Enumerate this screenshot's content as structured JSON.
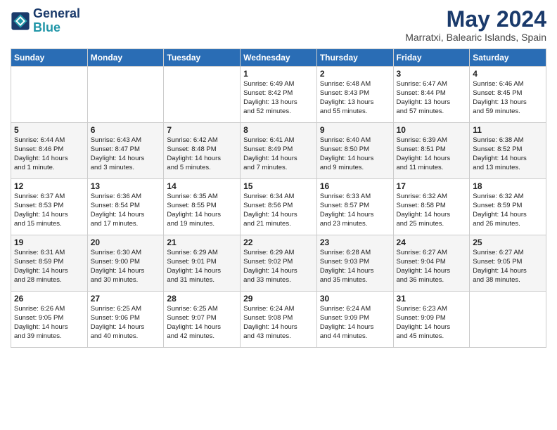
{
  "logo": {
    "line1": "General",
    "line2": "Blue"
  },
  "title": "May 2024",
  "location": "Marratxi, Balearic Islands, Spain",
  "days_of_week": [
    "Sunday",
    "Monday",
    "Tuesday",
    "Wednesday",
    "Thursday",
    "Friday",
    "Saturday"
  ],
  "weeks": [
    [
      {
        "day": "",
        "info": ""
      },
      {
        "day": "",
        "info": ""
      },
      {
        "day": "",
        "info": ""
      },
      {
        "day": "1",
        "info": "Sunrise: 6:49 AM\nSunset: 8:42 PM\nDaylight: 13 hours\nand 52 minutes."
      },
      {
        "day": "2",
        "info": "Sunrise: 6:48 AM\nSunset: 8:43 PM\nDaylight: 13 hours\nand 55 minutes."
      },
      {
        "day": "3",
        "info": "Sunrise: 6:47 AM\nSunset: 8:44 PM\nDaylight: 13 hours\nand 57 minutes."
      },
      {
        "day": "4",
        "info": "Sunrise: 6:46 AM\nSunset: 8:45 PM\nDaylight: 13 hours\nand 59 minutes."
      }
    ],
    [
      {
        "day": "5",
        "info": "Sunrise: 6:44 AM\nSunset: 8:46 PM\nDaylight: 14 hours\nand 1 minute."
      },
      {
        "day": "6",
        "info": "Sunrise: 6:43 AM\nSunset: 8:47 PM\nDaylight: 14 hours\nand 3 minutes."
      },
      {
        "day": "7",
        "info": "Sunrise: 6:42 AM\nSunset: 8:48 PM\nDaylight: 14 hours\nand 5 minutes."
      },
      {
        "day": "8",
        "info": "Sunrise: 6:41 AM\nSunset: 8:49 PM\nDaylight: 14 hours\nand 7 minutes."
      },
      {
        "day": "9",
        "info": "Sunrise: 6:40 AM\nSunset: 8:50 PM\nDaylight: 14 hours\nand 9 minutes."
      },
      {
        "day": "10",
        "info": "Sunrise: 6:39 AM\nSunset: 8:51 PM\nDaylight: 14 hours\nand 11 minutes."
      },
      {
        "day": "11",
        "info": "Sunrise: 6:38 AM\nSunset: 8:52 PM\nDaylight: 14 hours\nand 13 minutes."
      }
    ],
    [
      {
        "day": "12",
        "info": "Sunrise: 6:37 AM\nSunset: 8:53 PM\nDaylight: 14 hours\nand 15 minutes."
      },
      {
        "day": "13",
        "info": "Sunrise: 6:36 AM\nSunset: 8:54 PM\nDaylight: 14 hours\nand 17 minutes."
      },
      {
        "day": "14",
        "info": "Sunrise: 6:35 AM\nSunset: 8:55 PM\nDaylight: 14 hours\nand 19 minutes."
      },
      {
        "day": "15",
        "info": "Sunrise: 6:34 AM\nSunset: 8:56 PM\nDaylight: 14 hours\nand 21 minutes."
      },
      {
        "day": "16",
        "info": "Sunrise: 6:33 AM\nSunset: 8:57 PM\nDaylight: 14 hours\nand 23 minutes."
      },
      {
        "day": "17",
        "info": "Sunrise: 6:32 AM\nSunset: 8:58 PM\nDaylight: 14 hours\nand 25 minutes."
      },
      {
        "day": "18",
        "info": "Sunrise: 6:32 AM\nSunset: 8:59 PM\nDaylight: 14 hours\nand 26 minutes."
      }
    ],
    [
      {
        "day": "19",
        "info": "Sunrise: 6:31 AM\nSunset: 8:59 PM\nDaylight: 14 hours\nand 28 minutes."
      },
      {
        "day": "20",
        "info": "Sunrise: 6:30 AM\nSunset: 9:00 PM\nDaylight: 14 hours\nand 30 minutes."
      },
      {
        "day": "21",
        "info": "Sunrise: 6:29 AM\nSunset: 9:01 PM\nDaylight: 14 hours\nand 31 minutes."
      },
      {
        "day": "22",
        "info": "Sunrise: 6:29 AM\nSunset: 9:02 PM\nDaylight: 14 hours\nand 33 minutes."
      },
      {
        "day": "23",
        "info": "Sunrise: 6:28 AM\nSunset: 9:03 PM\nDaylight: 14 hours\nand 35 minutes."
      },
      {
        "day": "24",
        "info": "Sunrise: 6:27 AM\nSunset: 9:04 PM\nDaylight: 14 hours\nand 36 minutes."
      },
      {
        "day": "25",
        "info": "Sunrise: 6:27 AM\nSunset: 9:05 PM\nDaylight: 14 hours\nand 38 minutes."
      }
    ],
    [
      {
        "day": "26",
        "info": "Sunrise: 6:26 AM\nSunset: 9:05 PM\nDaylight: 14 hours\nand 39 minutes."
      },
      {
        "day": "27",
        "info": "Sunrise: 6:25 AM\nSunset: 9:06 PM\nDaylight: 14 hours\nand 40 minutes."
      },
      {
        "day": "28",
        "info": "Sunrise: 6:25 AM\nSunset: 9:07 PM\nDaylight: 14 hours\nand 42 minutes."
      },
      {
        "day": "29",
        "info": "Sunrise: 6:24 AM\nSunset: 9:08 PM\nDaylight: 14 hours\nand 43 minutes."
      },
      {
        "day": "30",
        "info": "Sunrise: 6:24 AM\nSunset: 9:09 PM\nDaylight: 14 hours\nand 44 minutes."
      },
      {
        "day": "31",
        "info": "Sunrise: 6:23 AM\nSunset: 9:09 PM\nDaylight: 14 hours\nand 45 minutes."
      },
      {
        "day": "",
        "info": ""
      }
    ]
  ]
}
